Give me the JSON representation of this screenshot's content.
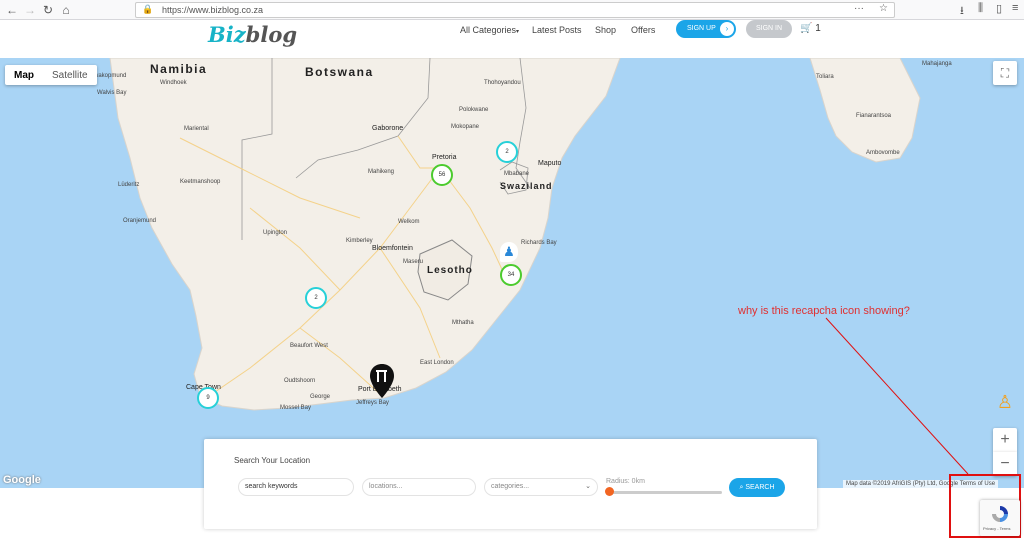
{
  "browser": {
    "url": "https://www.bizblog.co.za"
  },
  "header": {
    "logo_part1": "Biz",
    "logo_part2": "blog",
    "menu": [
      "All Categories",
      "Latest Posts",
      "Shop",
      "Offers"
    ],
    "signup_label": "SIGN UP",
    "signin_label": "SIGN IN",
    "cart_count": "1"
  },
  "map": {
    "type_map": "Map",
    "type_satellite": "Satellite",
    "countries": [
      "Namibia",
      "Botswana",
      "Swaziland",
      "Lesotho"
    ],
    "cities_major": [
      "Pretoria",
      "Gaborone",
      "Maputo",
      "Bloemfontein",
      "Port Elizabeth",
      "Cape Town"
    ],
    "cities_minor": [
      "Windhoek",
      "Walvis Bay",
      "Swakopmund",
      "Mariental",
      "Keetmanshoop",
      "Lüderitz",
      "Oranjemund",
      "Mahikeng",
      "Polokwane",
      "Mokopane",
      "Thohoyandou",
      "Mbabane",
      "Richards Bay",
      "Welkom",
      "Kimberley",
      "Upington",
      "Maseru",
      "Mthatha",
      "East London",
      "Beaufort West",
      "Oudtshoorn",
      "George",
      "Mossel Bay",
      "Jeffreys Bay",
      "Toliara",
      "Fianarantsoa",
      "Ambovombe",
      "Mahajanga"
    ],
    "clusters": [
      {
        "count": "2",
        "kind": "cyan"
      },
      {
        "count": "56",
        "kind": "green"
      },
      {
        "count": "34",
        "kind": "green"
      },
      {
        "count": "2",
        "kind": "cyan"
      },
      {
        "count": "9",
        "kind": "cyan"
      }
    ],
    "google_logo": "Google",
    "attribution": "Map data ©2019 AfriGIS (Pty) Ltd, Google   Terms of Use"
  },
  "search": {
    "title": "Search Your Location",
    "keywords_value": "search keywords",
    "locations_placeholder": "locations...",
    "categories_placeholder": "categories...",
    "radius_label": "Radius: 0km",
    "button_label": "SEARCH"
  },
  "annotation": {
    "text": "why is this recapcha icon showing?"
  },
  "recaptcha": {
    "links": "Privacy - Terms"
  }
}
